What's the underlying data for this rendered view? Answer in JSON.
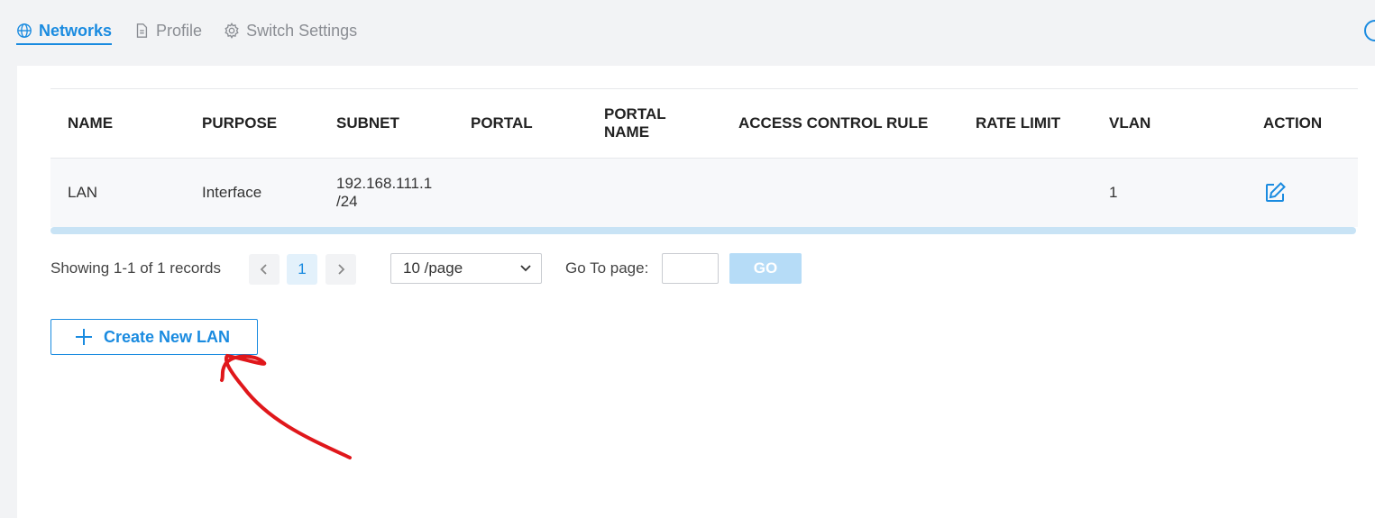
{
  "tabs": [
    {
      "label": "Networks",
      "icon": "globe-icon",
      "active": true
    },
    {
      "label": "Profile",
      "icon": "document-icon",
      "active": false
    },
    {
      "label": "Switch Settings",
      "icon": "gear-icon",
      "active": false
    }
  ],
  "table": {
    "headers": {
      "name": "NAME",
      "purpose": "PURPOSE",
      "subnet": "SUBNET",
      "portal": "PORTAL",
      "portal_name": "PORTAL NAME",
      "access_control_rule": "ACCESS CONTROL RULE",
      "rate_limit": "RATE LIMIT",
      "vlan": "VLAN",
      "action": "ACTION"
    },
    "rows": [
      {
        "name": "LAN",
        "purpose": "Interface",
        "subnet": "192.168.111.1 /24",
        "portal": "",
        "portal_name": "",
        "access_control_rule": "",
        "rate_limit": "",
        "vlan": "1",
        "action_icon": "edit-icon"
      }
    ]
  },
  "pagination": {
    "records_text": "Showing 1-1 of 1 records",
    "current_page": "1",
    "prev_icon": "chevron-left-icon",
    "next_icon": "chevron-right-icon",
    "page_size": "10 /page",
    "goto_label": "Go To page:",
    "goto_value": "",
    "go_label": "GO"
  },
  "create_button": {
    "label": "Create New LAN",
    "icon": "plus-icon"
  },
  "colors": {
    "accent": "#1a8be0",
    "annotation": "#e0171b"
  }
}
